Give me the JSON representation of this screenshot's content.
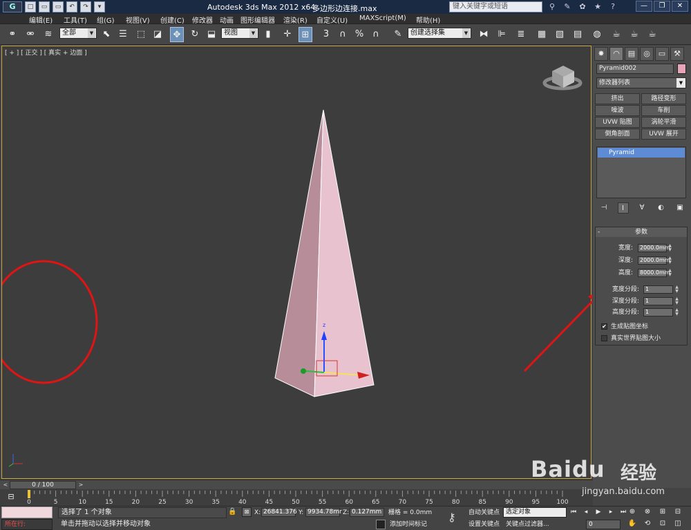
{
  "titlebar": {
    "logo": "G",
    "app_title": "Autodesk 3ds Max  2012 x64",
    "file_title": "多边形边连接.max",
    "search_placeholder": "键入关键字或短语",
    "quick_access": [
      "□",
      "▭",
      "▭",
      "↶",
      "↷",
      "▾"
    ],
    "tools": [
      "⚲",
      "✎",
      "✿",
      "★",
      "?"
    ],
    "window_controls": [
      "—",
      "❐",
      "✕"
    ]
  },
  "menu": [
    "编辑(E)",
    "工具(T)",
    "组(G)",
    "视图(V)",
    "创建(C)",
    "修改器",
    "动画",
    "图形编辑器",
    "渲染(R)",
    "自定义(U)",
    "MAXScript(M)",
    "帮助(H)"
  ],
  "toolbar": {
    "filter_value": "全部",
    "refcoord_value": "视图",
    "selection_set_value": "创建选择集",
    "snap_labels": [
      "3",
      "∩",
      "%",
      "∩"
    ]
  },
  "viewport": {
    "label": "[ + ] [ 正交 ] [ 真实 + 边面 ]",
    "gizmo_z": "z"
  },
  "panel": {
    "tabs": [
      "✸",
      "◠",
      "▤",
      "◎",
      "▭",
      "⚒"
    ],
    "object_name": "Pyramid002",
    "object_color": "#e6a5b8",
    "modifier_list": "修改器列表",
    "modifier_buttons": [
      "挤出",
      "路径变形",
      "噪波",
      "车削",
      "UVW 贴图",
      "涡轮平滑",
      "倒角剖面",
      "UVW 展开"
    ],
    "stack_item": "Pyramid",
    "stack_tools": [
      "⊣",
      "I",
      "∀",
      "◐",
      "▣"
    ],
    "params": {
      "title": "参数",
      "collapse": "-",
      "rows": [
        {
          "label": "宽度:",
          "value": "2000.0mm"
        },
        {
          "label": "深度:",
          "value": "2000.0mm"
        },
        {
          "label": "高度:",
          "value": "8000.0mm"
        }
      ],
      "segments": [
        {
          "label": "宽度分段:",
          "value": "1"
        },
        {
          "label": "深度分段:",
          "value": "1"
        },
        {
          "label": "高度分段:",
          "value": "1"
        }
      ],
      "checks": [
        {
          "label": "生成贴图坐标",
          "checked": true,
          "mark": "✔"
        },
        {
          "label": "真实世界贴图大小",
          "checked": false,
          "mark": ""
        }
      ]
    }
  },
  "timeline": {
    "frame_display": "0 / 100",
    "prev": "<",
    "next": ">",
    "tick_labels": [
      "0",
      "5",
      "10",
      "15",
      "20",
      "25",
      "30",
      "35",
      "40",
      "45",
      "50",
      "55",
      "60",
      "65",
      "70",
      "75",
      "80",
      "85",
      "90",
      "95",
      "100"
    ]
  },
  "status": {
    "running_label": "所在行:",
    "message_selected": "选择了 1 个对象",
    "message_hint": "单击并拖动以选择并移动对象",
    "x_label": "X:",
    "x_value": "26841.376",
    "y_label": "Y:",
    "y_value": "9934.78mr",
    "z_label": "Z:",
    "z_value": "0.127mm",
    "grid": "栅格 = 0.0mm",
    "add_time_tag": "添加时间标记",
    "auto_key": "自动关键点",
    "set_key": "设置关键点",
    "selection_filter": "选定对象",
    "key_filters": "关键点过滤器...",
    "frame_number": "0",
    "playback": [
      "⏮",
      "◂",
      "▶",
      "▸",
      "⏭"
    ],
    "nav_icons": [
      "⊕",
      "⊗",
      "⊞",
      "⊟",
      "✋",
      "⟲",
      "⊡",
      "◫"
    ]
  },
  "watermark": {
    "logo": "Bai百度",
    "logo_text": "Baidu",
    "cn": "经验",
    "url": "jingyan.baidu.com"
  }
}
